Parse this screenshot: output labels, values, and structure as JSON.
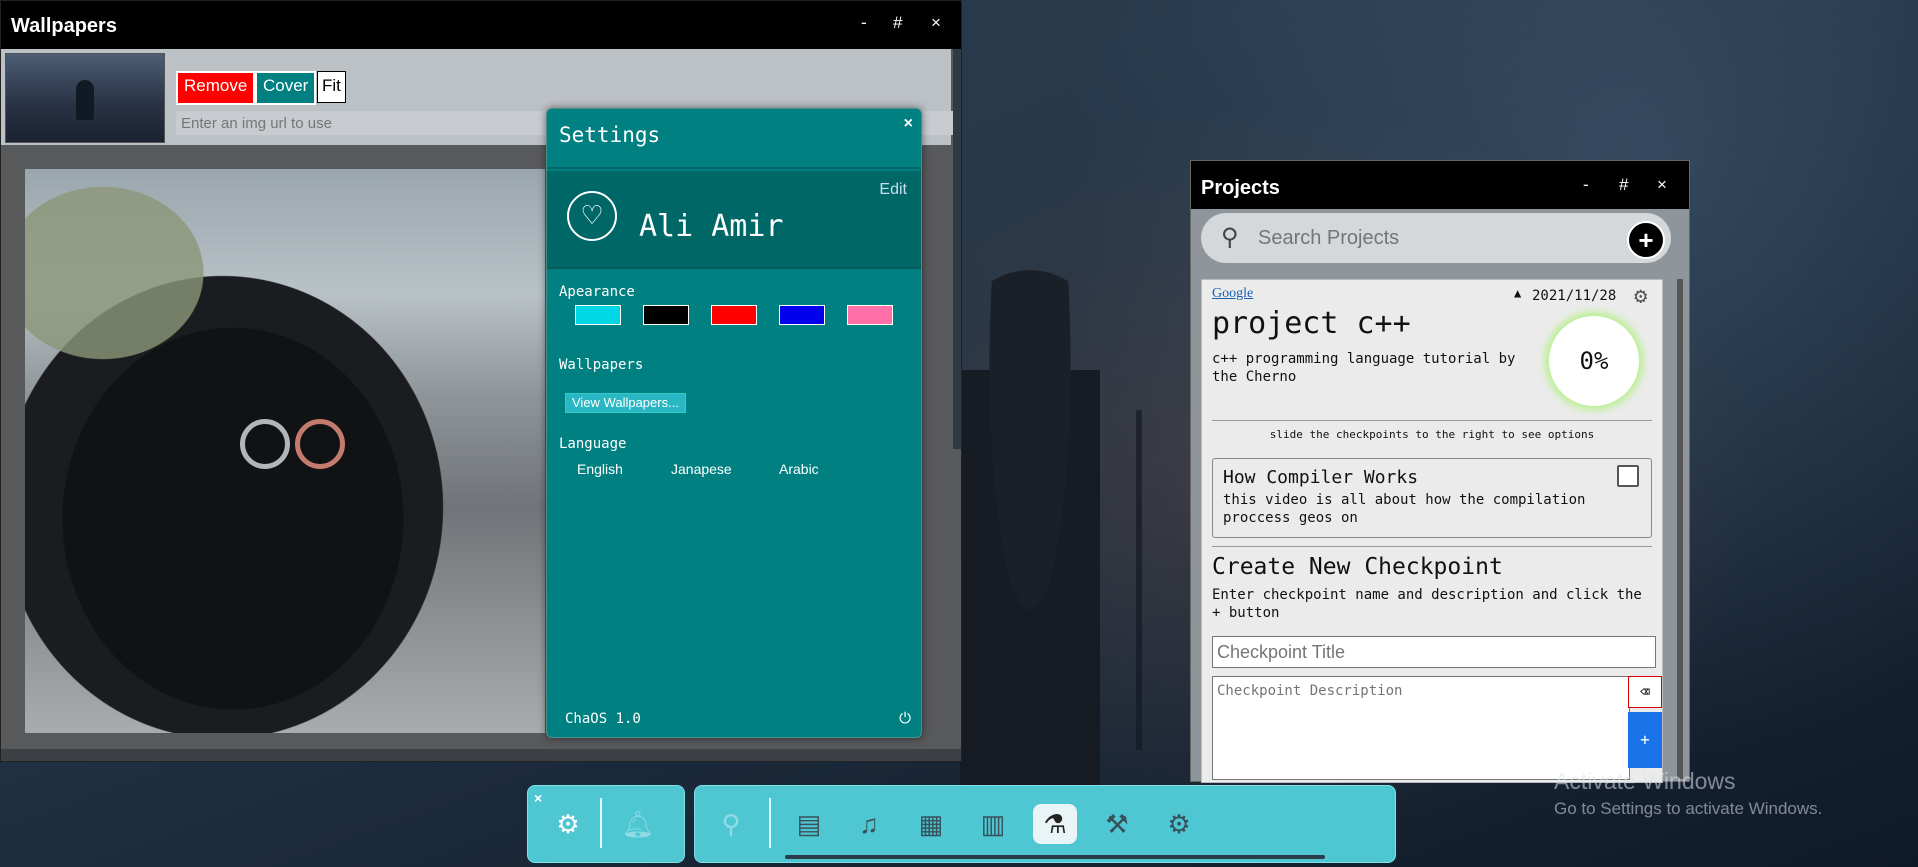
{
  "wallpapers_window": {
    "title": "Wallpapers",
    "minimize": "-",
    "maximize": "#",
    "close": "×",
    "remove_label": "Remove",
    "cover_label": "Cover",
    "fit_label": "Fit",
    "url_placeholder": "Enter an img url to use"
  },
  "settings": {
    "title": "Settings",
    "close": "×",
    "edit_label": "Edit",
    "user_name": "Ali Amir",
    "appearance_label": "Apearance",
    "colors": [
      "#00d7e6",
      "#000000",
      "#ff0000",
      "#0000ee",
      "#ff6fa8"
    ],
    "wallpapers_label": "Wallpapers",
    "view_wallpapers_label": "View Wallpapers...",
    "language_label": "Language",
    "languages": [
      "English",
      "Janapese",
      "Arabic"
    ],
    "version": "ChaOS 1.0"
  },
  "projects_window": {
    "title": "Projects",
    "minimize": "-",
    "maximize": "#",
    "close": "×",
    "search_placeholder": "Search Projects",
    "add": "+",
    "project": {
      "source": "Google",
      "date": "2021/11/28",
      "name": "project c++",
      "description": "c++ programming language tutorial by the Cherno",
      "progress": "0%",
      "hint": "slide the checkpoints to the right to see options",
      "checkpoint": {
        "title": "How Compiler Works",
        "description": "this video is all about how the compilation proccess geos on"
      },
      "create_title": "Create New Checkpoint",
      "create_desc": "Enter checkpoint name and description and click the + button",
      "cp_title_placeholder": "Checkpoint Title",
      "cp_desc_placeholder": "Checkpoint Description",
      "add_checkpoint": "+"
    }
  },
  "activate_windows": {
    "line1": "Activate Windows",
    "line2": "Go to Settings to activate Windows."
  },
  "taskbar": {
    "close": "×",
    "icons_left": [
      "settings-icon",
      "bell-icon"
    ],
    "icons_right": [
      "search-icon",
      "notes-icon",
      "music-icon",
      "calendar-icon",
      "book-icon",
      "flask-icon",
      "tools-icon",
      "gear-icon"
    ]
  }
}
